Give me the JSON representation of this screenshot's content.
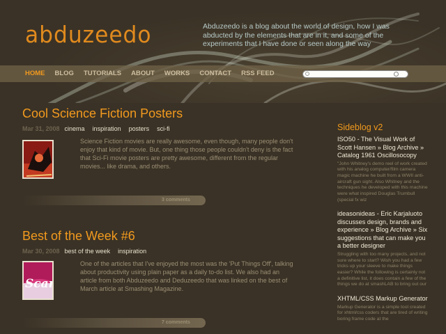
{
  "header": {
    "logo": "abduzeedo",
    "tagline": "Abduzeedo is a blog about the world of design, how I was abducted by the elements that are in it, and some of the experiments that I have done or seen along the way"
  },
  "nav": {
    "items": [
      "HOME",
      "BLOG",
      "TUTORIALS",
      "ABOUT",
      "WORKS",
      "CONTACT",
      "RSS FEED"
    ],
    "active": "HOME"
  },
  "search": {
    "value": ""
  },
  "posts": [
    {
      "title": "Cool Science Fiction Posters",
      "date": "Mar 31, 2008",
      "tags": [
        "cinema",
        "inspiration",
        "posters",
        "sci-fi"
      ],
      "excerpt": "Science Fiction movies are really awesome, even though, many people don't enjoy that kind of movie. But, one thing those people couldn't deny is the fact that Sci-Fi movie posters are pretty awesome, different from the regular movies... like drama, and others.",
      "comments": "3 comments"
    },
    {
      "title": "Best of the Week #6",
      "date": "Mar 30, 2008",
      "tags": [
        "best of the week",
        "inspiration"
      ],
      "excerpt": "One of the articles that I've enjoyed the most was the 'Put Things Off', talking about productivity using plain paper as a daily to-do list. We also had an article from both Abduzeedo and Deduzeedo that was linked on the best of March article at Smashing Magazine.",
      "comments": "7 comments",
      "thumb_text": "Scar"
    }
  ],
  "sidebar": {
    "title": "Sideblog v2",
    "items": [
      {
        "title": "ISO50 - The Visual Work of Scott Hansen » Blog Archive » Catalog 1961 Oscillosocopy",
        "desc": "\"John Whitney's demo reel of work created with his analog computer/film camera magic machine he built from a WWII anti-aircraft gun sight. Also Whitney and the techniques he developed with this machine were what inspired Douglas Trumbull (special fx wiz"
      },
      {
        "title": "ideasonideas - Eric Karjaluoto discusses design, brands and experience » Blog Archive » Six suggestions that can make you a better designer",
        "desc": "Struggling with too many projects, and not sure where to start? Wish you had a few tricks up your sleeve to make things easier? While the following is certainly not a definitive list, it does contain a few of the things we do at smashLAB to bring out our"
      },
      {
        "title": "XHTML/CSS Markup Generator",
        "desc": "Markup Generator is a simple tool created for xhtml/css coders that are tired of writing boring frame code at the"
      }
    ]
  },
  "colors": {
    "accent": "#f29a1e",
    "background": "#3a3226",
    "navbar": "#6e6046"
  }
}
